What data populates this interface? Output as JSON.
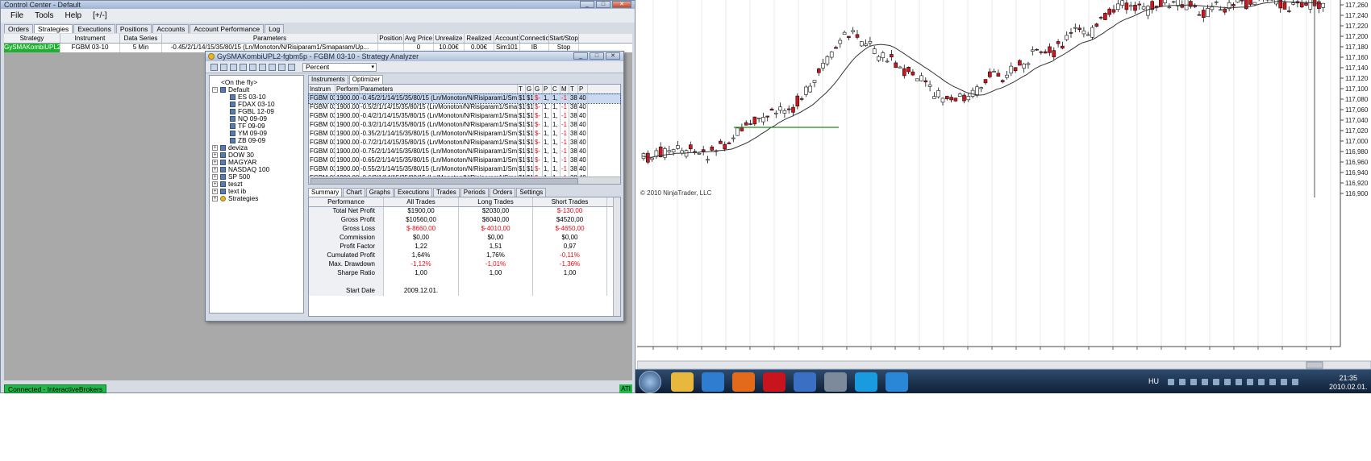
{
  "control_center": {
    "title": "Control Center - Default",
    "menu": [
      "File",
      "Tools",
      "Help",
      "[+/-]"
    ],
    "tabs": [
      "Orders",
      "Strategies",
      "Executions",
      "Positions",
      "Accounts",
      "Account Performance",
      "Log"
    ],
    "columns": [
      "Strategy",
      "Instrument",
      "Data Series",
      "Parameters",
      "Position",
      "Avg Price",
      "Unrealize",
      "Realized",
      "Account",
      "Connectio",
      "Start/Stop"
    ],
    "row": [
      "GySMAKombiUPL2",
      "FGBM 03-10",
      "5 Min",
      "-0.45/2/1/14/15/35/80/15 (Ln/Monoton/N/Risiparam1/Smaparam/Up...",
      "",
      "0",
      "10.00€",
      "0.00€",
      "Sim101",
      "IB",
      "Stop"
    ],
    "status": "Connected - InteractiveBrokers",
    "status_right": "ATI"
  },
  "analyzer": {
    "title": "GySMAKombiUPL2-fgbm5p - FGBM 03-10 - Strategy Analyzer",
    "combo": "Percent",
    "tree": {
      "on_the_fly": "<On the fly>",
      "default": "Default",
      "default_children": [
        "ES 03-10",
        "FDAX 03-10",
        "FGBL 12-09",
        "NQ 09-09",
        "TF 09-09",
        "YM 09-09",
        "ZB 09-09"
      ],
      "groups": [
        "deviza",
        "DOW 30",
        "MAGYAR",
        "NASDAQ 100",
        "SP 500",
        "teszt",
        "text ib",
        "Strategies"
      ]
    },
    "top_tabs": [
      "Instruments",
      "Optimizer"
    ],
    "opt_columns": [
      "Instrum",
      "Perform",
      "Parameters",
      "T",
      "G",
      "G",
      "P",
      "C",
      "M",
      "T",
      "P"
    ],
    "opt_rows": [
      [
        "FGBM 03",
        "1900.00",
        "-0.45/2/1/14/15/35/80/15 (Ln/Monoton/N/Risiparam1/Smaparam/U",
        "$1",
        "$1",
        "$-",
        "1,",
        "1,",
        "-1",
        "38",
        "40"
      ],
      [
        "FGBM 03",
        "1900.00",
        "-0.5/2/1/14/15/35/80/15 (Ln/Monoton/N/Risiparam1/Smaparam/Up",
        "$1",
        "$1",
        "$-",
        "1,",
        "1,",
        "-1",
        "38",
        "40"
      ],
      [
        "FGBM 03",
        "1900.00",
        "-0.4/2/1/14/15/35/80/15 (Ln/Monoton/N/Risiparam1/Smaparam/Up",
        "$1",
        "$1",
        "$-",
        "1,",
        "1,",
        "-1",
        "38",
        "40"
      ],
      [
        "FGBM 03",
        "1900.00",
        "-0.3/2/1/14/15/35/80/15 (Ln/Monoton/N/Risiparam1/Smaparam/Up",
        "$1",
        "$1",
        "$-",
        "1,",
        "1,",
        "-1",
        "38",
        "40"
      ],
      [
        "FGBM 03",
        "1900.00",
        "-0.35/2/1/14/15/35/80/15 (Ln/Monoton/N/Risiparam1/Smaparam/U",
        "$1",
        "$1",
        "$-",
        "1,",
        "1,",
        "-1",
        "38",
        "40"
      ],
      [
        "FGBM 03",
        "1900.00",
        "-0.7/2/1/14/15/35/80/15 (Ln/Monoton/N/Risiparam1/Smaparam/Up",
        "$1",
        "$1",
        "$-",
        "1,",
        "1,",
        "-1",
        "38",
        "40"
      ],
      [
        "FGBM 03",
        "1900.00",
        "-0.75/2/1/14/15/35/80/15 (Ln/Monoton/N/Risiparam1/Smaparam/U",
        "$1",
        "$1",
        "$-",
        "1,",
        "1,",
        "-1",
        "38",
        "40"
      ],
      [
        "FGBM 03",
        "1900.00",
        "-0.65/2/1/14/15/35/80/15 (Ln/Monoton/N/Risiparam1/Smaparam/U",
        "$1",
        "$1",
        "$-",
        "1,",
        "1,",
        "-1",
        "38",
        "40"
      ],
      [
        "FGBM 03",
        "1900.00",
        "-0.55/2/1/14/15/35/80/15 (Ln/Monoton/N/Risiparam1/Smaparam/U",
        "$1",
        "$1",
        "$-",
        "1,",
        "1,",
        "-1",
        "38",
        "40"
      ],
      [
        "FGBM 03",
        "1900.00",
        "-0.6/2/1/14/15/35/80/15 (Ln/Monoton/N/Risiparam1/Smaparam/Up",
        "$1",
        "$1",
        "$-",
        "1,",
        "1,",
        "-1",
        "38",
        "40"
      ]
    ],
    "bottom_tabs": [
      "Summary",
      "Chart",
      "Graphs",
      "Executions",
      "Trades",
      "Periods",
      "Orders",
      "Settings"
    ],
    "summary_columns": [
      "Performance",
      "All Trades",
      "Long Trades",
      "Short Trades"
    ],
    "summary_rows": [
      {
        "label": "Total Net Profit",
        "all": "$1900,00",
        "long": "$2030,00",
        "short": "$-130,00",
        "neg": [
          false,
          false,
          true
        ]
      },
      {
        "label": "Gross Profit",
        "all": "$10560,00",
        "long": "$6040,00",
        "short": "$4520,00",
        "neg": [
          false,
          false,
          false
        ]
      },
      {
        "label": "Gross Loss",
        "all": "$-8660,00",
        "long": "$-4010,00",
        "short": "$-4650,00",
        "neg": [
          true,
          true,
          true
        ]
      },
      {
        "label": "Commission",
        "all": "$0,00",
        "long": "$0,00",
        "short": "$0,00",
        "neg": [
          false,
          false,
          false
        ]
      },
      {
        "label": "Profit Factor",
        "all": "1,22",
        "long": "1,51",
        "short": "0,97",
        "neg": [
          false,
          false,
          false
        ]
      },
      {
        "label": "Cumulated Profit",
        "all": "1,64%",
        "long": "1,76%",
        "short": "-0,11%",
        "neg": [
          false,
          false,
          true
        ]
      },
      {
        "label": "Max. Drawdown",
        "all": "-1,12%",
        "long": "-1,01%",
        "short": "-1,36%",
        "neg": [
          true,
          true,
          true
        ]
      },
      {
        "label": "Sharpe Ratio",
        "all": "1,00",
        "long": "1,00",
        "short": "1,00",
        "neg": [
          false,
          false,
          false
        ]
      },
      {
        "label": "",
        "all": "",
        "long": "",
        "short": "",
        "neg": [
          false,
          false,
          false
        ]
      },
      {
        "label": "Start Date",
        "all": "2009.12.01.",
        "long": "",
        "short": "",
        "neg": [
          false,
          false,
          false
        ]
      }
    ]
  },
  "chart": {
    "copyright": "© 2010 NinjaTrader, LLC",
    "price_labels": [
      "117,260",
      "117,240",
      "117,220",
      "117,200",
      "117,180",
      "117,160",
      "117,140",
      "117,120",
      "117,100",
      "117,080",
      "117,060",
      "117,040",
      "117,020",
      "117,000",
      "116,980",
      "116,960",
      "116,940",
      "116,920",
      "116,900"
    ],
    "up_color": "#ffffff",
    "down_color": "#d4141c",
    "sma_color": "#333333",
    "line_color": "#1e8a1e"
  },
  "taskbar": {
    "lang": "HU",
    "time": "21:35",
    "date": "2010.02.01."
  },
  "colors": {
    "strategy_green": "#20b030",
    "status_green": "#22b84a",
    "negative": "#e0101b"
  }
}
